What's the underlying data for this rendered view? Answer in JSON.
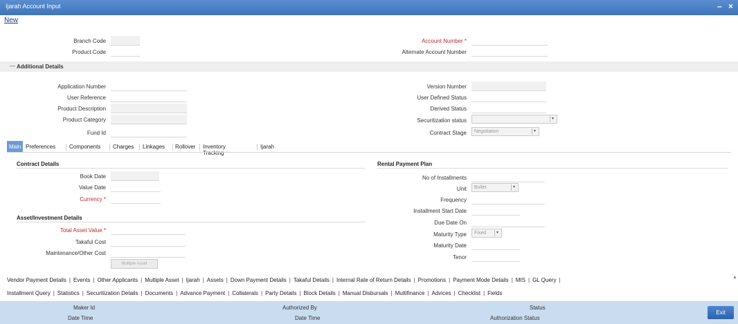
{
  "window": {
    "title": "Ijarah Account Input",
    "minimize": "–",
    "close": "×"
  },
  "toolbar": {
    "new_label": "New"
  },
  "header": {
    "branch_code_label": "Branch Code",
    "product_code_label": "Product Code",
    "account_number_label": "Account Number",
    "alternate_account_number_label": "Alternate Account Number"
  },
  "additional": {
    "collapse_icon": "minus-icon",
    "title": "Additional Details",
    "application_number_label": "Application Number",
    "user_reference_label": "User Reference",
    "product_description_label": "Product Description",
    "product_category_label": "Product Category",
    "fund_id_label": "Fund Id",
    "version_number_label": "Version Number",
    "user_defined_status_label": "User Defined Status",
    "derived_status_label": "Derived Status",
    "securitization_status_label": "Securitization status",
    "contract_stage_label": "Contract Stage",
    "contract_stage_value": "Negotiation"
  },
  "tabs": [
    "Main",
    "Preferences",
    "Components",
    "Charges",
    "Linkages",
    "Rollover",
    "Inventory Tracking",
    "Ijarah"
  ],
  "main": {
    "contract_details_title": "Contract Details",
    "book_date_label": "Book Date",
    "value_date_label": "Value Date",
    "currency_label": "Currency",
    "asset_title": "Asset/Investment Details",
    "total_asset_value_label": "Total Asset Value",
    "takaful_cost_label": "Takaful Cost",
    "maintenance_label": "Maintenance/Other Cost",
    "multiple_asset_button": "Multiple Asset",
    "rental_title": "Rental Payment Plan",
    "no_installments_label": "No of Installments",
    "unit_label": "Unit",
    "unit_value": "Bullet",
    "frequency_label": "Frequency",
    "installment_start_label": "Installment Start Date",
    "due_date_label": "Due Date On",
    "maturity_type_label": "Maturity Type",
    "maturity_type_value": "Fixed",
    "maturity_date_label": "Maturity Date",
    "tenor_label": "Tenor"
  },
  "links_row1": [
    "Vendor Payment Details",
    "Events",
    "Other Applicants",
    "Multiple Asset",
    "Ijarah",
    "Assets",
    "Down Payment Details",
    "Takaful Details",
    "Internal Rate of Return Details",
    "Promotions",
    "Payment Mode Details",
    "MIS",
    "GL Query"
  ],
  "links_row2": [
    "Installment Query",
    "Statistics",
    "Securitization Details",
    "Documents",
    "Advance Payment",
    "Collaterals",
    "Party Details",
    "Block Details",
    "Manual Disbursals",
    "Multifinance",
    "Advices",
    "Checklist",
    "Fields"
  ],
  "footer": {
    "maker_id": "Maker Id",
    "date_time_1": "Date Time",
    "authorized_by": "Authorized By",
    "date_time_2": "Date Time",
    "status": "Status",
    "authorization_status": "Authorization Status",
    "exit": "Exit"
  }
}
